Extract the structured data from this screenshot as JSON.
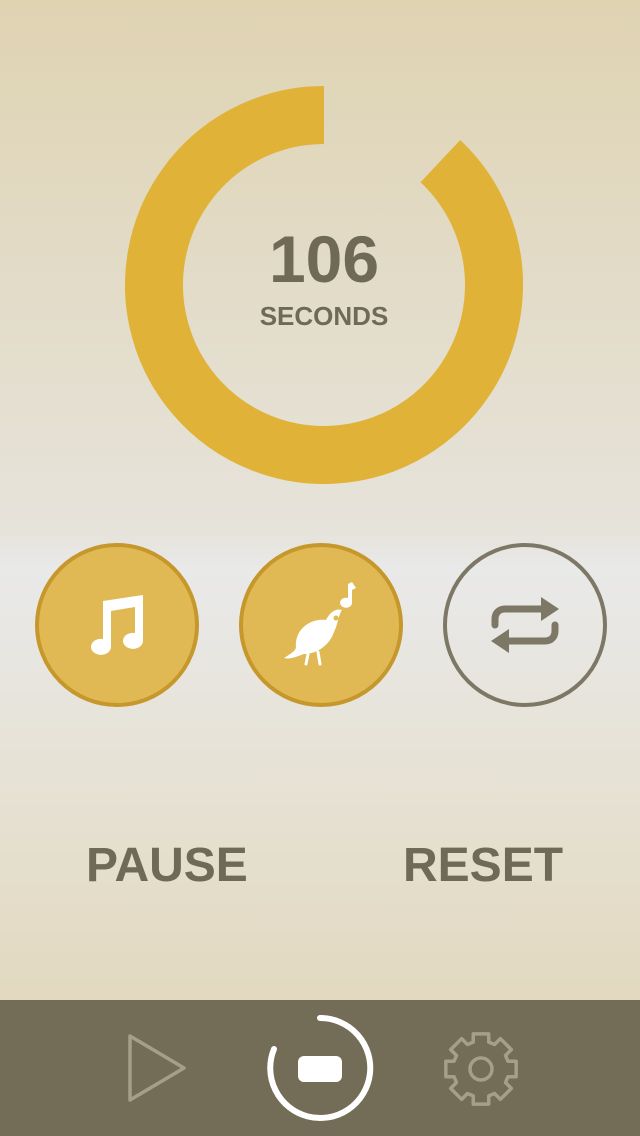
{
  "timer": {
    "value": "106",
    "unit": "SECONDS",
    "progress_fraction": 0.88,
    "ring_color": "#e0b238"
  },
  "sound_buttons": [
    {
      "icon": "music-note-icon",
      "state": "selected"
    },
    {
      "icon": "bird-icon",
      "state": "selected"
    },
    {
      "icon": "repeat-icon",
      "state": "unselected"
    }
  ],
  "controls": {
    "pause_label": "PAUSE",
    "reset_label": "RESET"
  },
  "tabbar": {
    "items": [
      {
        "icon": "play-icon",
        "active": false
      },
      {
        "icon": "stop-icon",
        "active": true
      },
      {
        "icon": "gear-icon",
        "active": false
      }
    ],
    "background_color": "#736c57"
  },
  "colors": {
    "accent_gold": "#e0b955",
    "text_brown": "#6f6a56"
  }
}
